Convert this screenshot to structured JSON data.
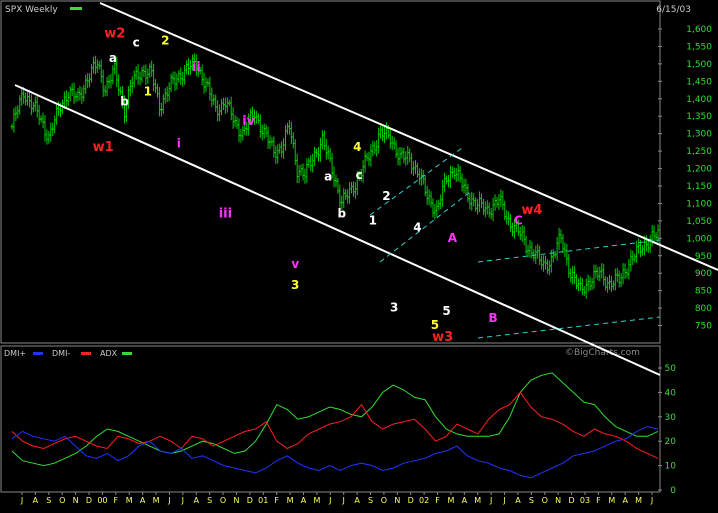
{
  "chart_data": [
    {
      "type": "ohlc",
      "header_left": "SPX Weekly",
      "header_right": "6/15/03",
      "watermark": "©BigCharts.com",
      "ylim": [
        720,
        1620
      ],
      "y_ticks": [
        "1,600",
        "1,550",
        "1,500",
        "1,450",
        "1,400",
        "1,350",
        "1,300",
        "1,250",
        "1,200",
        "1,150",
        "1,100",
        "1,050",
        "1,000",
        "950",
        "900",
        "850",
        "800",
        "750"
      ],
      "x_tick_labels": [
        "J",
        "A",
        "S",
        "O",
        "N",
        "D",
        "00",
        "F",
        "M",
        "A",
        "M",
        "J",
        "J",
        "A",
        "S",
        "O",
        "N",
        "D",
        "01",
        "F",
        "M",
        "A",
        "M",
        "J",
        "J",
        "A",
        "S",
        "O",
        "N",
        "D",
        "02",
        "F",
        "M",
        "A",
        "M",
        "J",
        "J",
        "A",
        "S",
        "O",
        "N",
        "D",
        "03",
        "F",
        "M",
        "A",
        "M",
        "J"
      ],
      "price_colors": {
        "bars": "#00cc00",
        "channel": "#ffffff",
        "dashed": "#33cccc"
      },
      "close_anchors": [
        [
          0,
          1320
        ],
        [
          6,
          1420
        ],
        [
          14,
          1350
        ],
        [
          19,
          1290
        ],
        [
          25,
          1380
        ],
        [
          29,
          1420
        ],
        [
          34,
          1400
        ],
        [
          39,
          1460
        ],
        [
          44,
          1500
        ],
        [
          48,
          1430
        ],
        [
          53,
          1480
        ],
        [
          58,
          1370
        ],
        [
          62,
          1450
        ],
        [
          67,
          1480
        ],
        [
          72,
          1470
        ],
        [
          76,
          1380
        ],
        [
          82,
          1440
        ],
        [
          87,
          1470
        ],
        [
          91,
          1490
        ],
        [
          95,
          1500
        ],
        [
          100,
          1440
        ],
        [
          105,
          1370
        ],
        [
          110,
          1390
        ],
        [
          115,
          1330
        ],
        [
          119,
          1300
        ],
        [
          125,
          1360
        ],
        [
          130,
          1300
        ],
        [
          135,
          1250
        ],
        [
          139,
          1260
        ],
        [
          143,
          1320
        ],
        [
          147,
          1200
        ],
        [
          151,
          1180
        ],
        [
          155,
          1230
        ],
        [
          160,
          1280
        ],
        [
          165,
          1200
        ],
        [
          170,
          1100
        ],
        [
          175,
          1140
        ],
        [
          181,
          1200
        ],
        [
          186,
          1260
        ],
        [
          190,
          1300
        ],
        [
          195,
          1290
        ],
        [
          200,
          1230
        ],
        [
          205,
          1230
        ],
        [
          210,
          1180
        ],
        [
          214,
          1120
        ],
        [
          219,
          1080
        ],
        [
          224,
          1170
        ],
        [
          228,
          1200
        ],
        [
          234,
          1130
        ],
        [
          239,
          1100
        ],
        [
          245,
          1080
        ],
        [
          251,
          1110
        ],
        [
          256,
          1050
        ],
        [
          261,
          1020
        ],
        [
          265,
          980
        ],
        [
          269,
          960
        ],
        [
          274,
          920
        ],
        [
          278,
          940
        ],
        [
          283,
          1000
        ],
        [
          288,
          900
        ],
        [
          293,
          850
        ],
        [
          298,
          880
        ],
        [
          303,
          900
        ],
        [
          308,
          870
        ],
        [
          313,
          880
        ],
        [
          317,
          920
        ],
        [
          321,
          950
        ],
        [
          325,
          980
        ],
        [
          330,
          1000
        ],
        [
          333,
          1010
        ]
      ],
      "wave_labels": [
        {
          "text": "w2",
          "x": 53,
          "price": 1575,
          "color": "#ff2020"
        },
        {
          "text": "c",
          "x": 64,
          "price": 1550,
          "color": "#ffffff"
        },
        {
          "text": "2",
          "x": 79,
          "price": 1555,
          "color": "#ffff33"
        },
        {
          "text": "a",
          "x": 52,
          "price": 1505,
          "color": "#ffffff"
        },
        {
          "text": "ii",
          "x": 95,
          "price": 1480,
          "color": "#ff33ff"
        },
        {
          "text": "1",
          "x": 70,
          "price": 1410,
          "color": "#ffff33"
        },
        {
          "text": "b",
          "x": 58,
          "price": 1380,
          "color": "#ffffff"
        },
        {
          "text": "w1",
          "x": 47,
          "price": 1250,
          "color": "#ff2020"
        },
        {
          "text": "i",
          "x": 86,
          "price": 1260,
          "color": "#ff33ff"
        },
        {
          "text": "iv",
          "x": 122,
          "price": 1325,
          "color": "#ff33ff"
        },
        {
          "text": "iii",
          "x": 110,
          "price": 1060,
          "color": "#ff33ff"
        },
        {
          "text": "4",
          "x": 178,
          "price": 1250,
          "color": "#ffff33"
        },
        {
          "text": "a",
          "x": 163,
          "price": 1165,
          "color": "#ffffff"
        },
        {
          "text": "c",
          "x": 179,
          "price": 1170,
          "color": "#ffffff"
        },
        {
          "text": "2",
          "x": 193,
          "price": 1110,
          "color": "#ffffff"
        },
        {
          "text": "b",
          "x": 170,
          "price": 1060,
          "color": "#ffffff"
        },
        {
          "text": "1",
          "x": 186,
          "price": 1040,
          "color": "#ffffff"
        },
        {
          "text": "4",
          "x": 209,
          "price": 1020,
          "color": "#ffffff"
        },
        {
          "text": "A",
          "x": 227,
          "price": 990,
          "color": "#ff33ff"
        },
        {
          "text": "C",
          "x": 261,
          "price": 1040,
          "color": "#ff33ff"
        },
        {
          "text": "w4",
          "x": 268,
          "price": 1070,
          "color": "#ff2020"
        },
        {
          "text": "v",
          "x": 146,
          "price": 915,
          "color": "#ff33ff"
        },
        {
          "text": "3",
          "x": 146,
          "price": 855,
          "color": "#ffff33"
        },
        {
          "text": "B",
          "x": 248,
          "price": 760,
          "color": "#ff33ff"
        },
        {
          "text": "3",
          "x": 197,
          "price": 790,
          "color": "#ffffff"
        },
        {
          "text": "5",
          "x": 224,
          "price": 780,
          "color": "#ffffff"
        },
        {
          "text": "5",
          "x": 218,
          "price": 740,
          "color": "#ffff33"
        },
        {
          "text": "w3",
          "x": 222,
          "price": 705,
          "color": "#ff2020"
        }
      ]
    },
    {
      "type": "line",
      "legend": [
        {
          "name": "DMI+",
          "color": "#2233ff"
        },
        {
          "name": "DMI-",
          "color": "#ff2020"
        },
        {
          "name": "ADX",
          "color": "#33dd33"
        }
      ],
      "ylim": [
        0,
        50
      ],
      "y_ticks": [
        "50",
        "40",
        "30",
        "20",
        "10",
        "0"
      ],
      "series": [
        {
          "name": "ADX",
          "color": "#33dd33",
          "values": [
            16,
            12,
            11,
            10,
            11,
            13,
            15,
            18,
            22,
            25,
            24,
            22,
            20,
            18,
            16,
            15,
            16,
            18,
            20,
            19,
            17,
            15,
            16,
            20,
            27,
            35,
            33,
            29,
            30,
            32,
            34,
            33,
            31,
            30,
            34,
            40,
            43,
            41,
            38,
            37,
            30,
            25,
            23,
            22,
            22,
            22,
            23,
            30,
            40,
            45,
            47,
            48,
            44,
            40,
            36,
            35,
            30,
            26,
            24,
            22,
            22,
            24
          ]
        },
        {
          "name": "DMI-",
          "color": "#ff2020",
          "values": [
            24,
            20,
            18,
            17,
            19,
            21,
            22,
            20,
            18,
            17,
            22,
            21,
            19,
            20,
            22,
            20,
            17,
            22,
            21,
            18,
            20,
            22,
            24,
            25,
            28,
            20,
            17,
            19,
            23,
            25,
            27,
            28,
            30,
            35,
            28,
            25,
            27,
            28,
            29,
            25,
            20,
            22,
            27,
            25,
            23,
            29,
            33,
            35,
            40,
            34,
            30,
            29,
            27,
            24,
            22,
            25,
            23,
            22,
            20,
            17,
            15,
            13
          ]
        },
        {
          "name": "DMI+",
          "color": "#2233ff",
          "values": [
            21,
            24,
            22,
            21,
            20,
            22,
            18,
            14,
            13,
            15,
            12,
            14,
            18,
            20,
            16,
            15,
            17,
            13,
            14,
            12,
            10,
            9,
            8,
            7,
            9,
            12,
            14,
            11,
            9,
            8,
            10,
            8,
            10,
            11,
            10,
            8,
            9,
            11,
            12,
            13,
            15,
            16,
            18,
            14,
            12,
            11,
            9,
            8,
            6,
            5,
            7,
            9,
            11,
            14,
            15,
            16,
            18,
            20,
            21,
            24,
            26,
            25
          ]
        }
      ]
    }
  ]
}
